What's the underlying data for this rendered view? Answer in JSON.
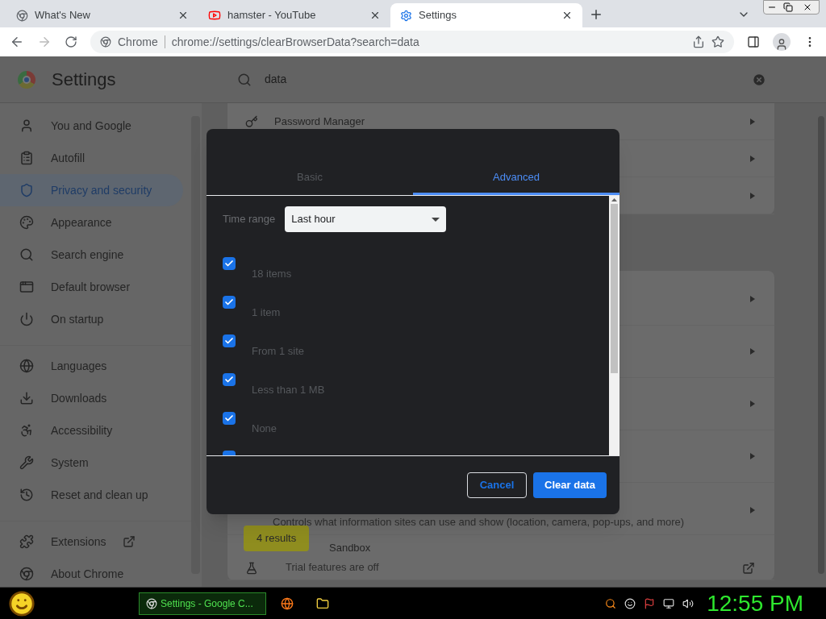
{
  "browser": {
    "tabs": [
      {
        "title": "What's New",
        "kind": "chrome",
        "selected": false
      },
      {
        "title": "hamster - YouTube",
        "kind": "youtube",
        "selected": false
      },
      {
        "title": "Settings",
        "kind": "settings",
        "selected": true
      }
    ],
    "address": {
      "site": "Chrome",
      "url": "chrome://settings/clearBrowserData?search=data"
    }
  },
  "settings": {
    "title": "Settings",
    "search": "data",
    "sidebar": [
      [
        {
          "label": "You and Google",
          "kind": "person",
          "selected": false
        },
        {
          "label": "Autofill",
          "kind": "clipboard",
          "selected": false
        },
        {
          "label": "Privacy and security",
          "kind": "shield",
          "selected": true
        },
        {
          "label": "Appearance",
          "kind": "palette",
          "selected": false
        },
        {
          "label": "Search engine",
          "kind": "search",
          "selected": false
        },
        {
          "label": "Default browser",
          "kind": "browser",
          "selected": false
        },
        {
          "label": "On startup",
          "kind": "power",
          "selected": false
        }
      ],
      [
        {
          "label": "Languages",
          "kind": "globe",
          "selected": false
        },
        {
          "label": "Downloads",
          "kind": "download",
          "selected": false
        },
        {
          "label": "Accessibility",
          "kind": "accessibility",
          "selected": false
        },
        {
          "label": "System",
          "kind": "wrench",
          "selected": false
        },
        {
          "label": "Reset and clean up",
          "kind": "history",
          "selected": false
        }
      ],
      [
        {
          "label": "Extensions",
          "kind": "puzzle",
          "selected": false,
          "external": true
        },
        {
          "label": "About Chrome",
          "kind": "chrome",
          "selected": false
        }
      ]
    ],
    "card_top": [
      {
        "label": "Password Manager",
        "kind": "key"
      }
    ],
    "card_main": [
      {
        "description": "Controls what information sites can use and show (location, camera, pop-ups, and more)"
      },
      {
        "label": "Sandbox",
        "description": "Trial features are off",
        "kind": "flask",
        "external": true
      }
    ],
    "results_badge": "4 results"
  },
  "dialog": {
    "tabs": [
      {
        "label": "Basic",
        "selected": false
      },
      {
        "label": "Advanced",
        "selected": true
      }
    ],
    "time_range": {
      "label": "Time range",
      "value": "Last hour"
    },
    "items": [
      {
        "label": "18 items",
        "checked": true
      },
      {
        "label": "1 item",
        "checked": true
      },
      {
        "label": "From 1 site",
        "checked": true
      },
      {
        "label": "Less than 1 MB",
        "checked": true
      },
      {
        "label": "None",
        "checked": true
      },
      {
        "checked": true
      }
    ],
    "buttons": [
      {
        "label": "Cancel",
        "kind": "secondary"
      },
      {
        "label": "Clear data",
        "kind": "primary"
      }
    ]
  },
  "taskbar": {
    "task": "Settings - Google C...",
    "clock": "12:55 PM"
  }
}
